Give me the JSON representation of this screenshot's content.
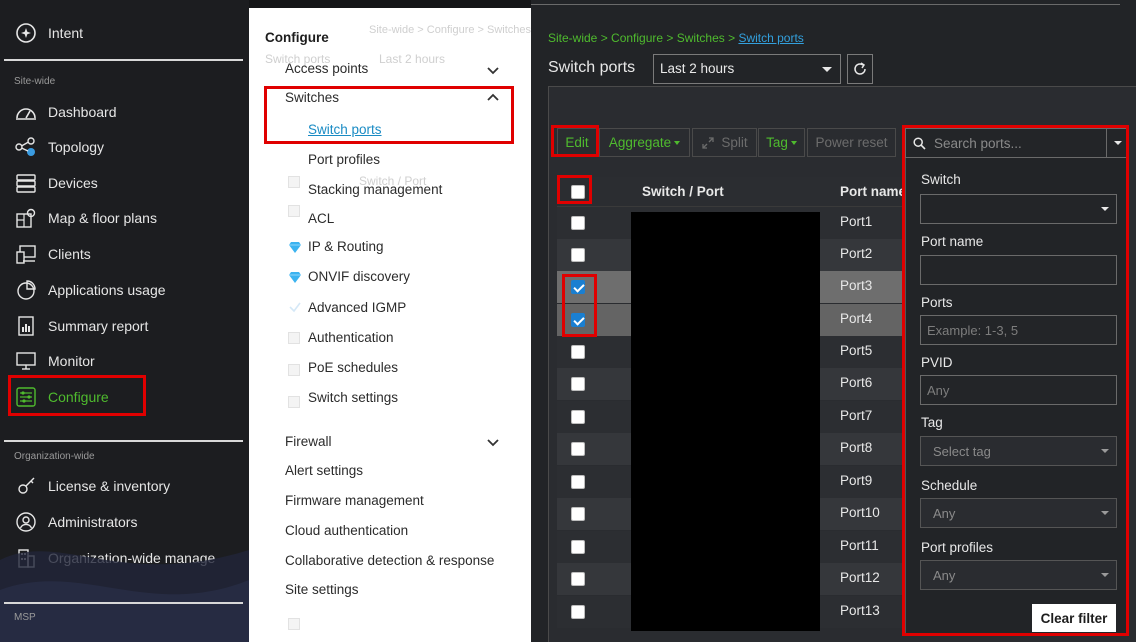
{
  "sidebar": {
    "intent": "Intent",
    "section_site": "Site-wide",
    "items": [
      {
        "label": "Dashboard",
        "icon": "dashboard-icon"
      },
      {
        "label": "Topology",
        "icon": "topology-icon"
      },
      {
        "label": "Devices",
        "icon": "devices-icon"
      },
      {
        "label": "Map & floor plans",
        "icon": "map-icon"
      },
      {
        "label": "Clients",
        "icon": "clients-icon"
      },
      {
        "label": "Applications usage",
        "icon": "pie-chart-icon"
      },
      {
        "label": "Summary report",
        "icon": "report-icon"
      },
      {
        "label": "Monitor",
        "icon": "monitor-icon"
      },
      {
        "label": "Configure",
        "icon": "configure-icon",
        "active": true
      }
    ],
    "section_org": "Organization-wide",
    "org_items": [
      {
        "label": "License & inventory",
        "icon": "license-icon"
      },
      {
        "label": "Administrators",
        "icon": "admin-icon"
      },
      {
        "label": "Organization-wide manage",
        "icon": "building-icon"
      }
    ],
    "section_msp": "MSP",
    "active_color": "#4fbb2e"
  },
  "submenu": {
    "title": "Configure",
    "access_points": "Access points",
    "switches": "Switches",
    "switch_items": [
      "Switch ports",
      "Port profiles",
      "Stacking management",
      "ACL",
      "IP & Routing",
      "ONVIF discovery",
      "Advanced IGMP",
      "Authentication",
      "PoE schedules",
      "Switch settings"
    ],
    "firewall": "Firewall",
    "other_items": [
      "Alert settings",
      "Firmware management",
      "Cloud authentication",
      "Collaborative detection & response",
      "Site settings"
    ],
    "ghost_texts": [
      "Site-wide > Configure > Switches > Switch ports",
      "Switch ports",
      "Last 2 hours",
      "Switch / Port"
    ]
  },
  "main": {
    "breadcrumb_path": "Site-wide > Configure > Switches > ",
    "breadcrumb_current": "Switch ports",
    "page_title": "Switch ports",
    "time_range": "Last 2 hours",
    "toolbar": {
      "edit": "Edit",
      "aggregate": "Aggregate",
      "split": "Split",
      "tag": "Tag",
      "power_reset": "Power reset"
    },
    "table": {
      "col_switch_port": "Switch / Port",
      "col_port_name": "Port name",
      "rows": [
        {
          "port": "Port1",
          "checked": false
        },
        {
          "port": "Port2",
          "checked": false
        },
        {
          "port": "Port3",
          "checked": true
        },
        {
          "port": "Port4",
          "checked": true
        },
        {
          "port": "Port5",
          "checked": false
        },
        {
          "port": "Port6",
          "checked": false
        },
        {
          "port": "Port7",
          "checked": false
        },
        {
          "port": "Port8",
          "checked": false
        },
        {
          "port": "Port9",
          "checked": false
        },
        {
          "port": "Port10",
          "checked": false
        },
        {
          "port": "Port11",
          "checked": false
        },
        {
          "port": "Port12",
          "checked": false
        },
        {
          "port": "Port13",
          "checked": false
        }
      ]
    }
  },
  "filter": {
    "search_placeholder": "Search ports...",
    "switch_label": "Switch",
    "switch_value": "",
    "port_name_label": "Port name",
    "port_name_value": "",
    "ports_label": "Ports",
    "ports_placeholder": "Example: 1-3, 5",
    "pvid_label": "PVID",
    "pvid_placeholder": "Any",
    "tag_label": "Tag",
    "tag_placeholder": "Select tag",
    "schedule_label": "Schedule",
    "schedule_value": "Any",
    "port_profiles_label": "Port profiles",
    "port_profiles_value": "Any",
    "clear_filter": "Clear filter"
  },
  "colors": {
    "accent_green": "#4fbb2e",
    "link_blue": "#33a0dd",
    "highlight_red": "#e00000",
    "checkbox_blue": "#1a7fd1"
  }
}
